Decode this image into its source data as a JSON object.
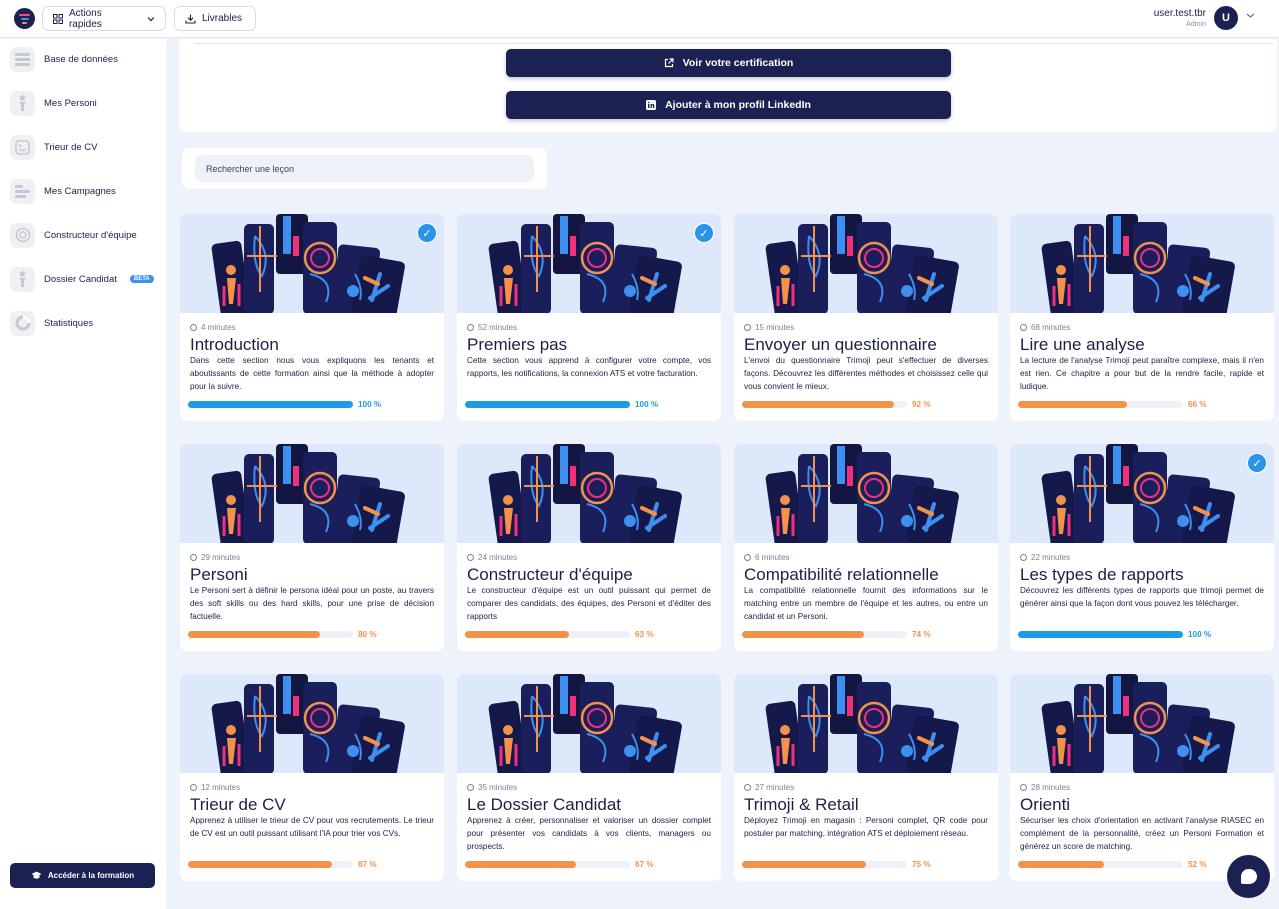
{
  "topbar": {
    "quick_actions": "Actions rapides",
    "deliverables": "Livrables",
    "user_name": "user.test.tbr",
    "user_role": "Admin",
    "avatar_letter": "U"
  },
  "sidebar": {
    "items": [
      {
        "label": "Base de données",
        "icon": "database-icon"
      },
      {
        "label": "Mes Personi",
        "icon": "persona-icon"
      },
      {
        "label": "Trieur de CV",
        "icon": "cv-sorter-icon"
      },
      {
        "label": "Mes Campagnes",
        "icon": "campaign-icon"
      },
      {
        "label": "Constructeur d'équipe",
        "icon": "team-builder-icon"
      },
      {
        "label": "Dossier Candidat",
        "icon": "candidate-file-icon",
        "badge": "BETA"
      },
      {
        "label": "Statistiques",
        "icon": "statistics-icon"
      }
    ],
    "cta": "Accéder à la formation"
  },
  "certification": {
    "view_button": "Voir votre certification",
    "linkedin_button": "Ajouter à mon profil LinkedIn"
  },
  "search": {
    "placeholder": "Rechercher une leçon"
  },
  "colors": {
    "navy": "#1b2152",
    "complete": "#1e9be6",
    "in_progress": "#f5924a"
  },
  "lessons": [
    {
      "duration": "4 minutes",
      "title": "Introduction",
      "description": "Dans cette section nous vous expliquons les tenants et aboutissants de cette formation ainsi que la méthode à adopter pour la suivre.",
      "progress": 100,
      "progress_label": "100 %",
      "completed": true
    },
    {
      "duration": "52 minutes",
      "title": "Premiers pas",
      "description": "Cette section vous apprend à configurer votre compte, vos rapports, les notifications, la connexion ATS et votre facturation.",
      "progress": 100,
      "progress_label": "100 %",
      "completed": true
    },
    {
      "duration": "15 minutes",
      "title": "Envoyer un questionnaire",
      "description": "L'envoi du questionnaire Trimoji peut s'effectuer de diverses façons. Découvrez les différentes méthodes et choisissez celle qui vous convient le mieux.",
      "progress": 92,
      "progress_label": "92 %",
      "completed": false
    },
    {
      "duration": "68 minutes",
      "title": "Lire une analyse",
      "description": "La lecture de l'analyse Trimoji peut paraître complexe, mais il n'en est rien. Ce chapitre a pour but de la rendre facile, rapide et ludique.",
      "progress": 66,
      "progress_label": "66 %",
      "completed": false
    },
    {
      "duration": "29 minutes",
      "title": "Personi",
      "description": "Le Personi sert à définir le persona idéal pour un poste, au travers des soft skills ou des hard skills, pour une prise de décision factuelle.",
      "progress": 80,
      "progress_label": "80 %",
      "completed": false
    },
    {
      "duration": "24 minutes",
      "title": "Constructeur d'équipe",
      "description": "Le constructeur d'équipe est un outil puissant qui permet de comparer des candidats, des équipes, des Personi et d'éditer des rapports",
      "progress": 63,
      "progress_label": "63 %",
      "completed": false
    },
    {
      "duration": "6 minutes",
      "title": "Compatibilité relationnelle",
      "description": "La compatibilité relationnelle fournit des informations sur le matching entre un membre de l'équipe et les autres, ou entre un candidat et un Personi.",
      "progress": 74,
      "progress_label": "74 %",
      "completed": false
    },
    {
      "duration": "22 minutes",
      "title": "Les types de rapports",
      "description": "Découvrez les différents types de rapports que trimoji permet de générer ainsi que la façon dont vous pouvez les télécharger.",
      "progress": 100,
      "progress_label": "100 %",
      "completed": true
    },
    {
      "duration": "12 minutes",
      "title": "Trieur de CV",
      "description": "Apprenez à utiliser le trieur de CV pour vos recrutements. Le trieur de CV est un outil puissant utilisant l'IA pour trier vos CVs.",
      "progress": 87,
      "progress_label": "87 %",
      "completed": false
    },
    {
      "duration": "35 minutes",
      "title": "Le Dossier Candidat",
      "description": "Apprenez à créer, personnaliser et valoriser un dossier complet pour présenter vos candidats à vos clients, managers ou prospects.",
      "progress": 67,
      "progress_label": "67 %",
      "completed": false
    },
    {
      "duration": "27 minutes",
      "title": "Trimoji & Retail",
      "description": "Déployez Trimoji en magasin : Personi complet, QR code pour postuler par matching, intégration ATS et déploiement réseau.",
      "progress": 75,
      "progress_label": "75 %",
      "completed": false
    },
    {
      "duration": "28 minutes",
      "title": "Orienti",
      "description": "Sécuriser les choix d'orientation en activant l'analyse RIASEC en complément de la personnalité, créez un Personi Formation et générez un score de matching.",
      "progress": 52,
      "progress_label": "52 %",
      "completed": false
    }
  ]
}
